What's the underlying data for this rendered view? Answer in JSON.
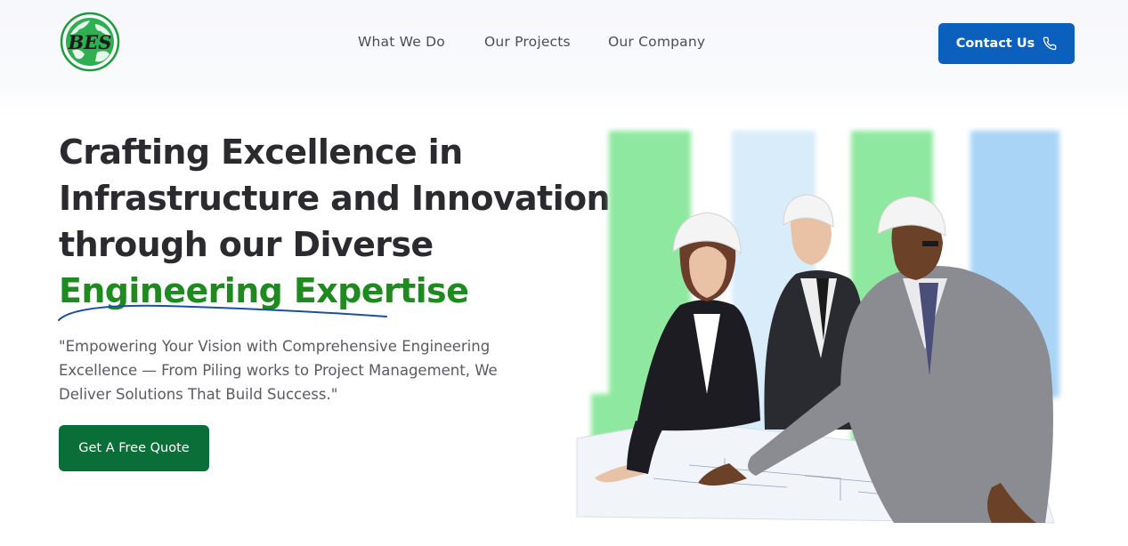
{
  "brand": {
    "logo_text": "BES",
    "logo_color": "#1f9a3e"
  },
  "nav": {
    "items": [
      {
        "label": "What We Do"
      },
      {
        "label": "Our Projects"
      },
      {
        "label": "Our Company"
      }
    ]
  },
  "header": {
    "contact_label": "Contact Us",
    "contact_icon": "phone-icon"
  },
  "hero": {
    "line1": "Crafting Excellence in",
    "line2": "Infrastructure and Innovation",
    "line3": "through our Diverse",
    "accent_line": "Engineering Expertise",
    "subtitle": "\"Empowering Your Vision with Comprehensive Engineering Excellence — From Piling works to Project Management, We Deliver Solutions That Build Success.\"",
    "cta_label": "Get A Free Quote"
  },
  "colors": {
    "accent_green": "#1f8a1f",
    "cta_green": "#0a6e38",
    "contact_blue": "#0b5fbd",
    "headline": "#2b2b2f"
  }
}
